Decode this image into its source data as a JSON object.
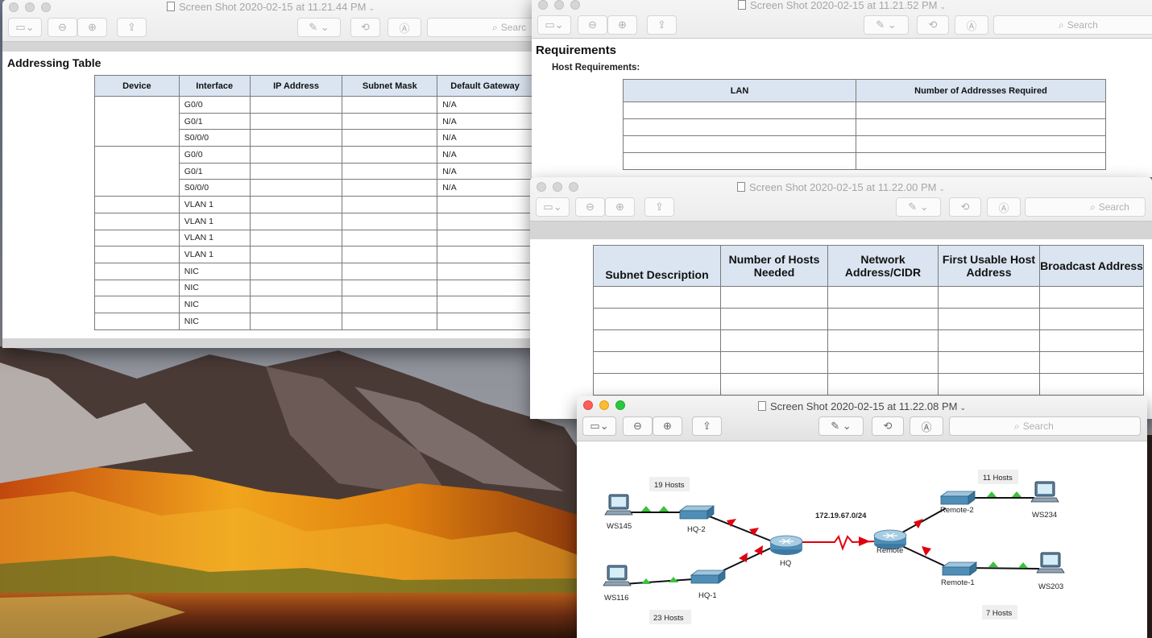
{
  "windows": {
    "addressing": {
      "title": "Screen Shot 2020-02-15 at 11.21.44 PM",
      "search_placeholder": "Searc",
      "heading": "Addressing Table",
      "columns": [
        "Device",
        "Interface",
        "IP Address",
        "Subnet Mask",
        "Default Gateway"
      ],
      "rows": [
        {
          "interface": "G0/0",
          "gateway": "N/A"
        },
        {
          "interface": "G0/1",
          "gateway": "N/A"
        },
        {
          "interface": "S0/0/0",
          "gateway": "N/A"
        },
        {
          "interface": "G0/0",
          "gateway": "N/A"
        },
        {
          "interface": "G0/1",
          "gateway": "N/A"
        },
        {
          "interface": "S0/0/0",
          "gateway": "N/A"
        },
        {
          "interface": "VLAN 1",
          "gateway": ""
        },
        {
          "interface": "VLAN 1",
          "gateway": ""
        },
        {
          "interface": "VLAN 1",
          "gateway": ""
        },
        {
          "interface": "VLAN 1",
          "gateway": ""
        },
        {
          "interface": "NIC",
          "gateway": ""
        },
        {
          "interface": "NIC",
          "gateway": ""
        },
        {
          "interface": "NIC",
          "gateway": ""
        },
        {
          "interface": "NIC",
          "gateway": ""
        }
      ]
    },
    "requirements": {
      "title": "Screen Shot 2020-02-15 at 11.21.52 PM",
      "search_placeholder": "Search",
      "heading": "Requirements",
      "subheading": "Host Requirements:",
      "columns": [
        "LAN",
        "Number of Addresses Required"
      ],
      "row_count": 4
    },
    "subnets": {
      "title": "Screen Shot 2020-02-15 at 11.22.00 PM",
      "search_placeholder": "Search",
      "columns": [
        "Subnet Description",
        "Number of Hosts Needed",
        "Network Address/CIDR",
        "First Usable Host Address",
        "Broadcast Address"
      ],
      "row_count": 5
    },
    "topology": {
      "title": "Screen Shot 2020-02-15 at 11.22.08 PM",
      "search_placeholder": "Search",
      "labels": {
        "ws145": "WS145",
        "ws116": "WS116",
        "ws234": "WS234",
        "ws203": "WS203",
        "hq2": "HQ-2",
        "hq1": "HQ-1",
        "hq": "HQ",
        "remote": "Remote",
        "remote2": "Remote-2",
        "remote1": "Remote-1",
        "hosts19": "19 Hosts",
        "hosts23": "23 Hosts",
        "hosts11": "11 Hosts",
        "hosts7": "7 Hosts",
        "network": "172.19.67.0/24"
      }
    }
  },
  "icons": [
    "sidebar-icon",
    "zoom-out-icon",
    "zoom-in-icon",
    "share-icon",
    "markup-pen-icon",
    "rotate-icon",
    "annotate-icon",
    "search-icon"
  ],
  "colors": {
    "header_fill": "#dbe5f1",
    "link_red": "#e0000f",
    "link_green_marker": "#3cc23c",
    "close": "#fc5f57",
    "minimize": "#fdbc2e",
    "zoom": "#2ac840"
  }
}
